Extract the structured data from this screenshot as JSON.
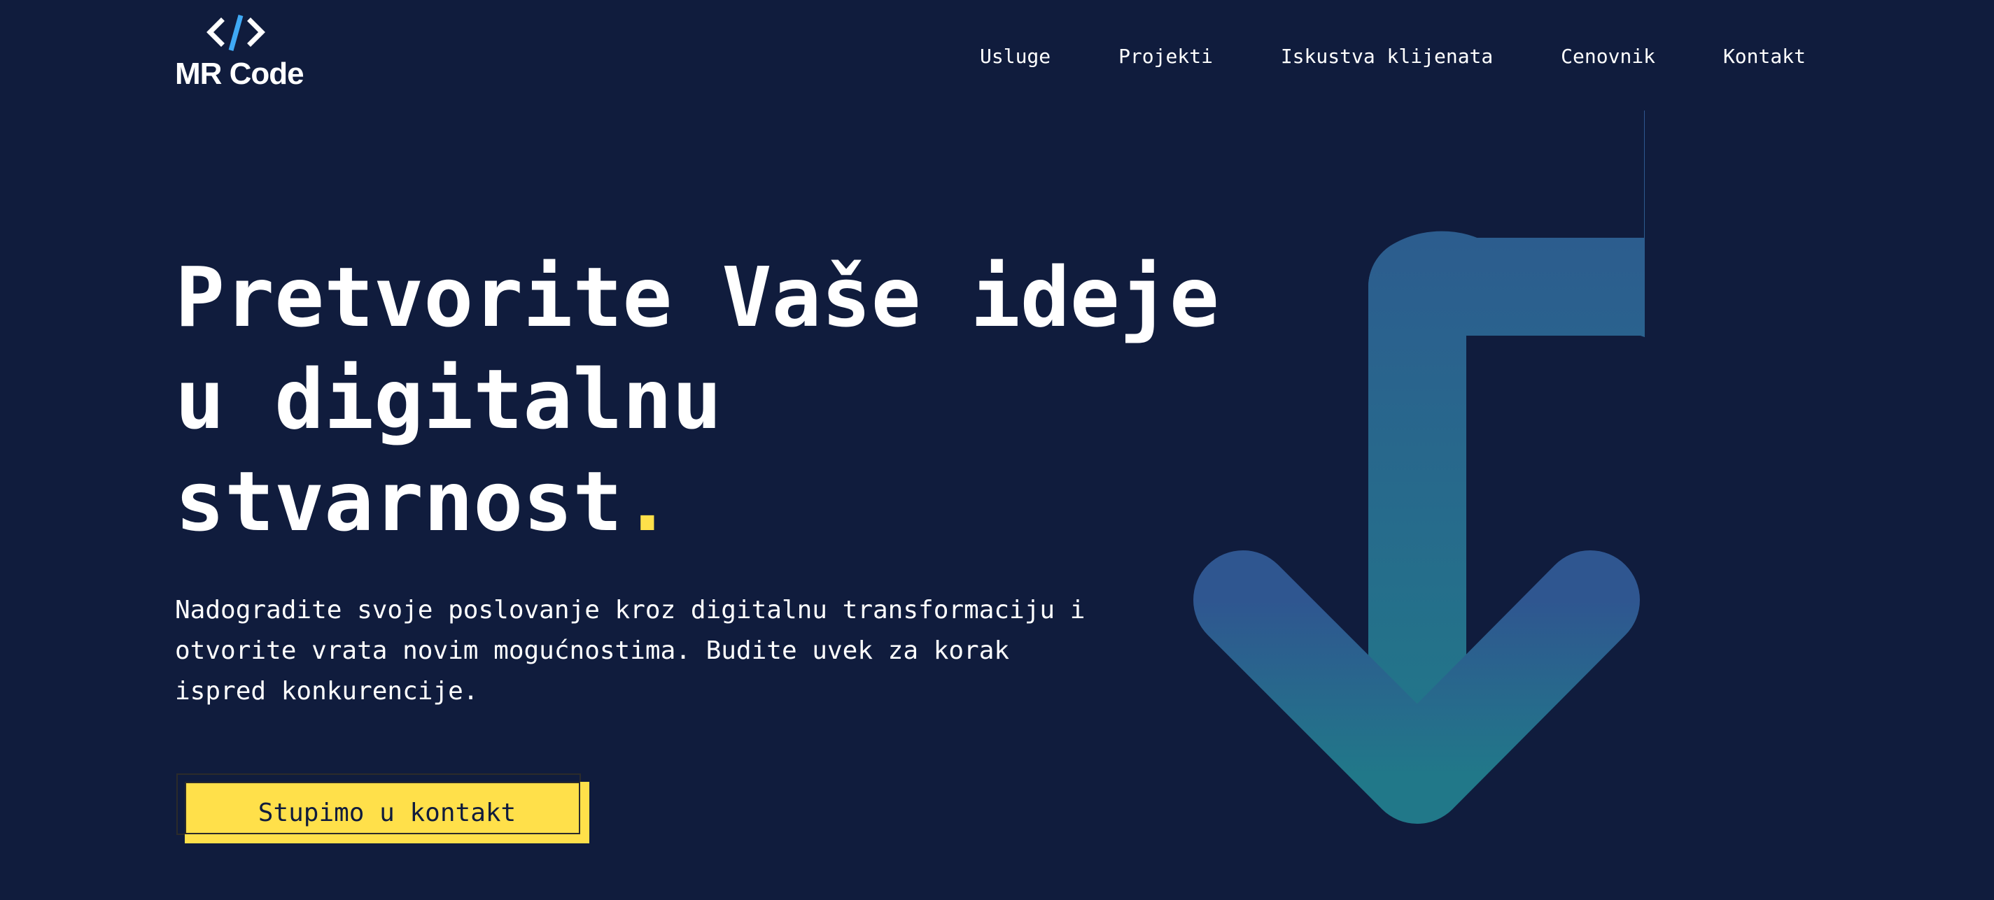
{
  "brand": {
    "logo_symbol": "</>",
    "name": "MR Code"
  },
  "nav": {
    "items": [
      "Usluge",
      "Projekti",
      "Iskustva klijenata",
      "Cenovnik",
      "Kontakt"
    ]
  },
  "hero": {
    "title_line1": "Pretvorite Vaše ideje",
    "title_line2": "u digitalnu",
    "title_line3": "stvarnost",
    "title_dot": ".",
    "description": "Nadogradite svoje poslovanje kroz digitalnu transformaciju i otvorite vrata novim mogućnostima. Budite uvek za korak ispred konkurencije.",
    "cta_label": "Stupimo u kontakt"
  },
  "colors": {
    "background": "#101c3d",
    "accent": "#ffe04a",
    "logo_accent": "#3fa9f5",
    "arrow_top": "#2f5690",
    "arrow_bottom": "#217889"
  }
}
